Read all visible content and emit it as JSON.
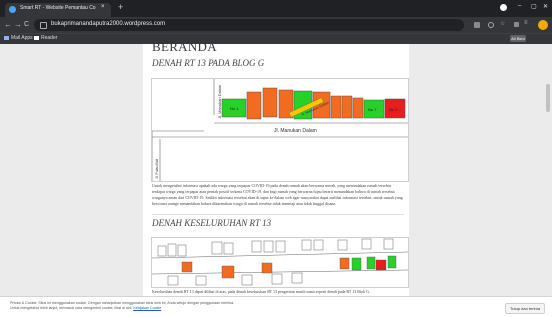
{
  "browser": {
    "tab_title": "Smart RT - Website Pemantau Co...",
    "tab_close": "×",
    "new_tab": "+",
    "window_controls": [
      "–",
      "▢",
      "✕"
    ],
    "nav": {
      "back": "←",
      "forward": "→",
      "reload": "C"
    },
    "url": "bukaprimanandaputra2000.wordpress.com",
    "bookmarks": [
      "Mail Apps",
      "Reader"
    ],
    "bookmark_right": "All Bkm"
  },
  "page": {
    "heading": "BERANDA",
    "section1_title": "DENAH RT 13 PADA BLOG G",
    "map1": {
      "street_vertical": "Jl. Manukan Dalam",
      "street_horizontal": "Jl. Manukan Dalam",
      "street_left": "Jl. Manukan Dalam",
      "street_left2": "Jl. Pulau Bali",
      "house_label_1": "No 1",
      "house_label_2": "No 7",
      "house_label_3": "No 9",
      "colors": {
        "green": "#27d127",
        "orange": "#f26b21",
        "red": "#e81d1d",
        "outline": "#555555"
      }
    },
    "paragraph1": "Untuk mengetahui informasi apakah ada warga yang terpapar COVID-19 pada denah rumah akan berwarna merah, yang menandakan rumah tersebut terdapat warga yang terpapar atau pernah positif terkena COVID-19, dan bagi rumah yang berwarna hijau berarti menandakan bahwa di rumah tersebut warganya aman dari COVID-19. Sedikit informasi tersebut akan di input ke dalam web agar masyarakat dapat melihat informasi tersebut, untuk rumah yang berwarna orange menandakan bahwa dikarenakan warga di rumah tersebut tidak menetap atau tidak tinggal disana.",
    "section2_title": "DENAH KESELURUHAN RT 13",
    "paragraph2": "Keseluruhan denah RT 13 dapat dilihat di atas, pada denah keseluruhan RT 13 pengertian masih sama seperti denah pada RT 13 Blok G."
  },
  "cookie": {
    "text": "Privasi & Cookie: Situs ini menggunakan cookie. Dengan melanjutkan menggunakan situs web ini, Anda setuju dengan penggunaan mereka.",
    "text2": "Untuk mengetahui lebih lanjut, termasuk cara mengontrol cookie, lihat di sini:",
    "link": "Kebijakan Cookie",
    "button": "Tutup dan terima"
  }
}
